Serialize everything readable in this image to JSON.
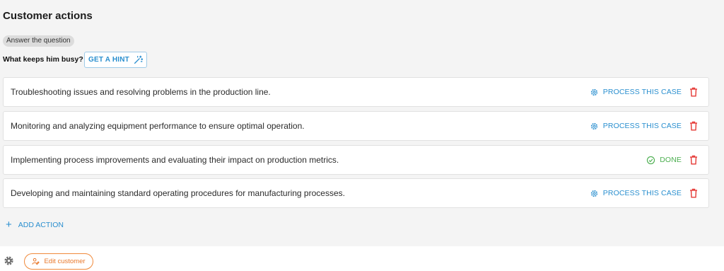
{
  "section": {
    "title": "Customer actions",
    "chip": "Answer the question",
    "question": "What keeps him busy?",
    "hint_label": "GET A HINT"
  },
  "actions": [
    {
      "text": "Troubleshooting issues and resolving problems in the production line.",
      "status": "process",
      "status_label": "PROCESS THIS CASE"
    },
    {
      "text": "Monitoring and analyzing equipment performance to ensure optimal operation.",
      "status": "process",
      "status_label": "PROCESS THIS CASE"
    },
    {
      "text": "Implementing process improvements and evaluating their impact on production metrics.",
      "status": "done",
      "status_label": "DONE"
    },
    {
      "text": "Developing and maintaining standard operating procedures for manufacturing processes.",
      "status": "process",
      "status_label": "PROCESS THIS CASE"
    }
  ],
  "add_action_label": "ADD ACTION",
  "footer": {
    "edit_label": "Edit customer"
  },
  "colors": {
    "accent_blue": "#2a8fcf",
    "done_green": "#4caf50",
    "delete_red": "#e53935",
    "edit_orange": "#e8772a"
  },
  "icons": {
    "hint": "magic-wand-icon",
    "process": "gear-icon",
    "done": "check-circle-icon",
    "delete": "trash-icon",
    "add": "plus-icon",
    "settings": "gear-icon",
    "edit": "user-edit-icon"
  }
}
